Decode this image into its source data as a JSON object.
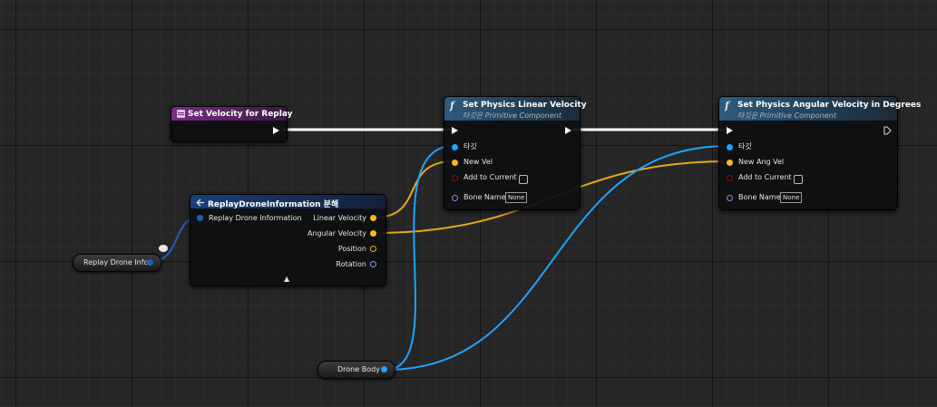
{
  "nodes": {
    "set_velocity_event": {
      "title": "Set Velocity for Replay",
      "header_color": "#7a2a86"
    },
    "break_struct": {
      "title": "ReplayDroneInformation 분해",
      "input_label": "Replay Drone Information",
      "outputs": [
        "Linear Velocity",
        "Angular Velocity",
        "Position",
        "Rotation"
      ],
      "header_color": "#1b3f7a"
    },
    "set_linear": {
      "title": "Set Physics Linear Velocity",
      "subtitle": "타깃은 Primitive Component",
      "pins": {
        "target": "타깃",
        "value": "New Vel",
        "add": "Add to Current",
        "bone": "Bone Name",
        "bone_value": "None"
      },
      "header_color": "#2e5b7e"
    },
    "set_angular": {
      "title": "Set Physics Angular Velocity in Degrees",
      "subtitle": "타깃은 Primitive Component",
      "pins": {
        "target": "타깃",
        "value": "New Ang Vel",
        "add": "Add to Current",
        "bone": "Bone Name",
        "bone_value": "None"
      },
      "header_color": "#2e5b7e"
    }
  },
  "variables": {
    "replay_info": "Replay Drone Info",
    "drone_body": "Drone Body"
  },
  "icons": {
    "function": "f",
    "event": "event-icon",
    "struct": "struct-break-icon",
    "expand": "▲"
  },
  "colors": {
    "exec_wire": "#ffffff",
    "object_wire": "#1ea3ff",
    "vector_wire": "#ffb81c",
    "struct_wire": "#1c5fbf"
  }
}
